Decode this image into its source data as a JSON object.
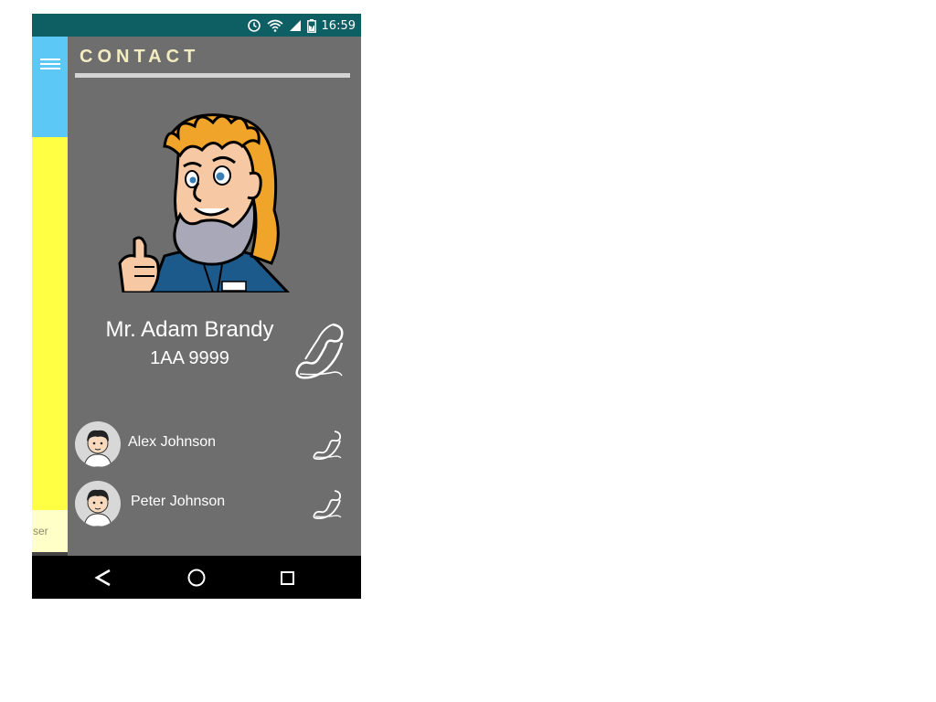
{
  "status_bar": {
    "time": "16:59",
    "icons": [
      "alarm-icon",
      "wifi-icon",
      "signal-icon",
      "battery-icon"
    ]
  },
  "drawer": {
    "menu_icon": "hamburger-icon",
    "partial_text": "ser",
    "colors": {
      "top": "#5bc8f5",
      "middle": "#ffff44",
      "bottom": "#ffffc8"
    }
  },
  "header": {
    "title": "CONTACT"
  },
  "main_contact": {
    "name": "Mr. Adam Brandy",
    "code": "1AA 9999",
    "call_icon": "phone-icon"
  },
  "contacts": [
    {
      "name": "Alex Johnson",
      "call_icon": "phone-icon"
    },
    {
      "name": "Peter Johnson",
      "call_icon": "phone-icon"
    }
  ],
  "nav_bar": {
    "buttons": [
      "back-icon",
      "home-icon",
      "recents-icon"
    ]
  },
  "colors": {
    "status_bar": "#0d5f63",
    "background": "#6e6e6e",
    "title": "#f3ecc0"
  }
}
